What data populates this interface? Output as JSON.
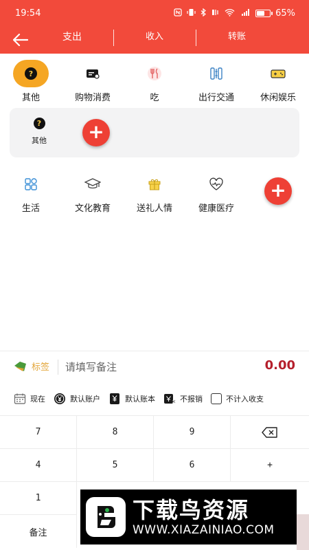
{
  "status_bar": {
    "time": "19:54",
    "battery_percent": "65%",
    "battery_level": 0.65,
    "icons": [
      "nfc-icon",
      "vibrate-icon",
      "bluetooth-icon",
      "signal-mute-icon",
      "wifi-icon",
      "5g-signal-icon",
      "battery-icon"
    ]
  },
  "header": {
    "tabs": [
      {
        "label": "支出",
        "active": true
      },
      {
        "label": "收入",
        "active": false
      },
      {
        "label": "转账",
        "active": false
      }
    ]
  },
  "categories_row1": [
    {
      "label": "其他",
      "icon": "question-icon",
      "selected": true
    },
    {
      "label": "购物消费",
      "icon": "card-icon"
    },
    {
      "label": "吃",
      "icon": "fork-knife-icon"
    },
    {
      "label": "出行交通",
      "icon": "transit-icon"
    },
    {
      "label": "休闲娱乐",
      "icon": "gamepad-icon"
    }
  ],
  "sub_panel": {
    "items": [
      {
        "label": "其他",
        "icon": "question-icon"
      }
    ]
  },
  "categories_row2": [
    {
      "label": "生活",
      "icon": "grid-icon"
    },
    {
      "label": "文化教育",
      "icon": "graduation-cap-icon"
    },
    {
      "label": "送礼人情",
      "icon": "gift-icon"
    },
    {
      "label": "健康医疗",
      "icon": "heart-pulse-icon"
    }
  ],
  "note": {
    "tag_label": "标签",
    "placeholder": "请填写备注",
    "amount": "0.00"
  },
  "options": [
    {
      "label": "现在",
      "icon": "calendar-icon"
    },
    {
      "label": "默认账户",
      "icon": "yen-coin-icon"
    },
    {
      "label": "默认账本",
      "icon": "yen-book-icon"
    },
    {
      "label": "不报销",
      "icon": "reimburse-icon"
    },
    {
      "label": "不计入收支",
      "icon": "checkbox-icon"
    }
  ],
  "keypad": {
    "keys": [
      "7",
      "8",
      "9",
      "4",
      "5",
      "6",
      "+",
      "1"
    ],
    "bottom_left": "备注",
    "delete_icon": "backspace-icon"
  },
  "watermark": {
    "title": "下载鸟资源",
    "url": "WWW.XIAZAINIAO.COM"
  },
  "colors": {
    "brand_red": "#f24a3b",
    "selected_orange": "#f5a623",
    "amount_red": "#b51f2c",
    "tag_gold": "#e3a63a"
  }
}
